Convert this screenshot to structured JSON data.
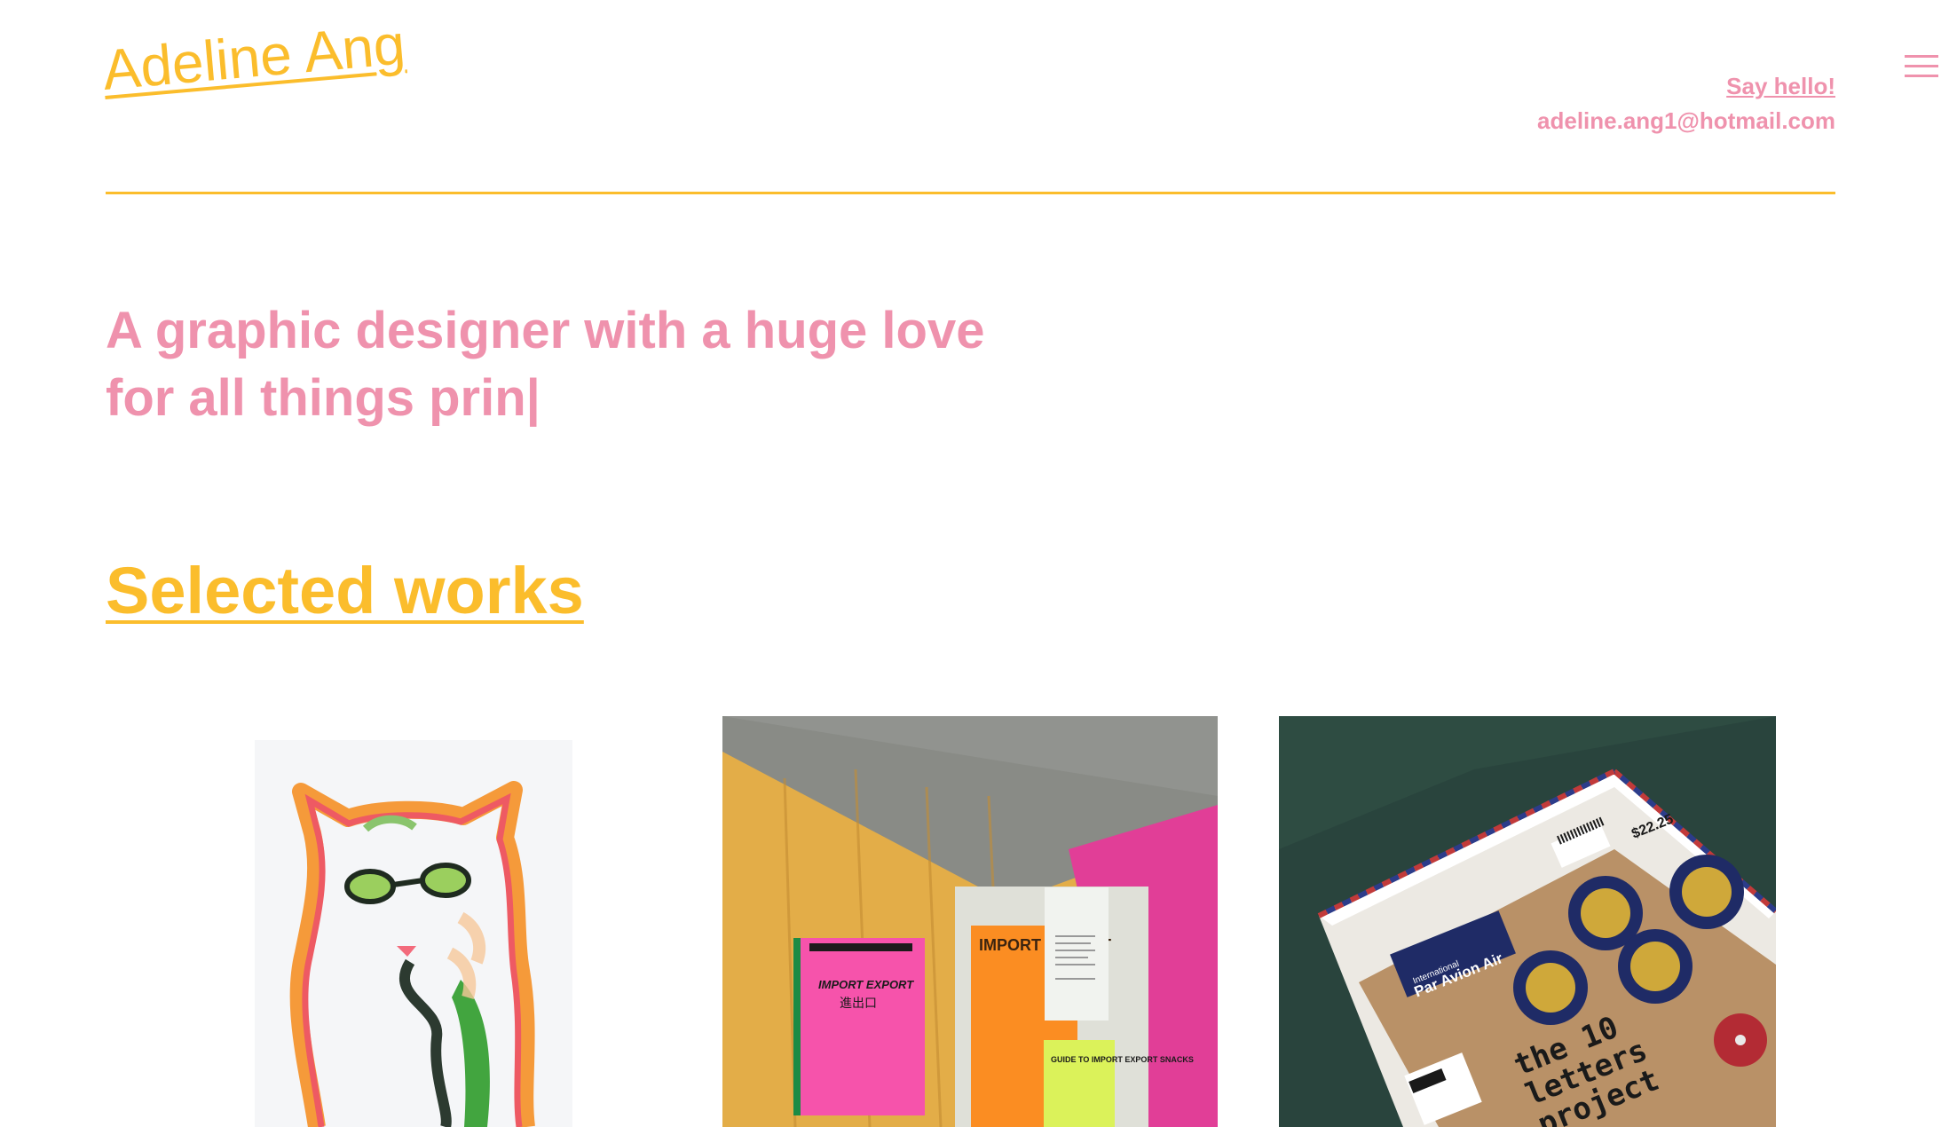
{
  "header": {
    "logo": "Adeline Ang",
    "say_hello": "Say hello!",
    "email": "adeline.ang1@hotmail.com",
    "menu_icon": "hamburger-menu-icon"
  },
  "hero": {
    "line1": "A graphic designer with a huge love",
    "line2": "for all things prin|"
  },
  "works": {
    "title": "Selected works",
    "items": [
      {
        "name": "cat-illustration"
      },
      {
        "name": "import-export-publication",
        "texts": {
          "cover": "IMPORT EXPORT",
          "chinese": "進出口",
          "notebook": "IMPORT EXPORT",
          "snacks": "GUIDE TO IMPORT EXPORT SNACKS"
        }
      },
      {
        "name": "10-letters-project",
        "texts": {
          "title_1": "the 10",
          "title_2": "letters",
          "title_3": "project",
          "airmail": "Par Avion Air",
          "international": "International",
          "price": "$22.25"
        }
      }
    ]
  },
  "colors": {
    "yellow": "#fbbd2c",
    "pink": "#ef92ad"
  }
}
